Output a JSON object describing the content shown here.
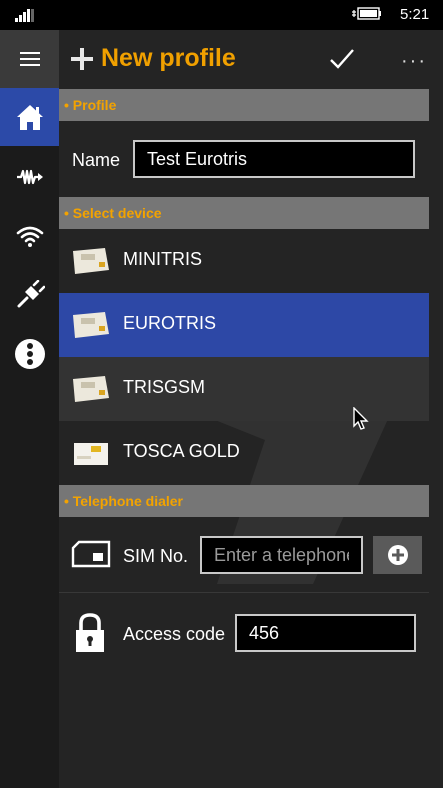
{
  "status_bar": {
    "time": "5:21",
    "signal_icon": "signal-bars-icon",
    "battery_icon": "battery-charging-icon"
  },
  "nav_rail": {
    "items": [
      {
        "name": "hamburger-menu",
        "icon": "hamburger-icon"
      },
      {
        "name": "home",
        "icon": "home-icon",
        "selected": true
      },
      {
        "name": "signal",
        "icon": "waveform-icon"
      },
      {
        "name": "wifi",
        "icon": "wifi-icon"
      },
      {
        "name": "plug",
        "icon": "plug-icon"
      },
      {
        "name": "more",
        "icon": "vertical-dots-icon"
      }
    ]
  },
  "header": {
    "title": "New profile",
    "confirm_icon": "checkmark-icon",
    "more_icon": "ellipsis-icon"
  },
  "profile_section": {
    "label": "• Profile",
    "name_label": "Name",
    "name_value": "Test Eurotris"
  },
  "device_section": {
    "label": "• Select device",
    "devices": [
      {
        "label": "MINITRIS",
        "icon": "device-panel-icon",
        "selected": false
      },
      {
        "label": "EUROTRIS",
        "icon": "device-panel-icon",
        "selected": true
      },
      {
        "label": "TRISGSM",
        "icon": "device-panel-icon",
        "selected": false
      },
      {
        "label": "TOSCA GOLD",
        "icon": "device-panel-icon",
        "selected": false
      }
    ]
  },
  "dialer_section": {
    "label": "• Telephone dialer",
    "sim_label": "SIM No.",
    "sim_value": "",
    "sim_placeholder": "Enter a telephone number",
    "add_icon": "plus-circle-icon",
    "access_label": "Access code",
    "access_value": "456"
  },
  "colors": {
    "accent": "#f0a000",
    "selected": "#2d48a6",
    "section_bar": "#767676",
    "rail": "#1b1b1b",
    "background": "#242424"
  }
}
